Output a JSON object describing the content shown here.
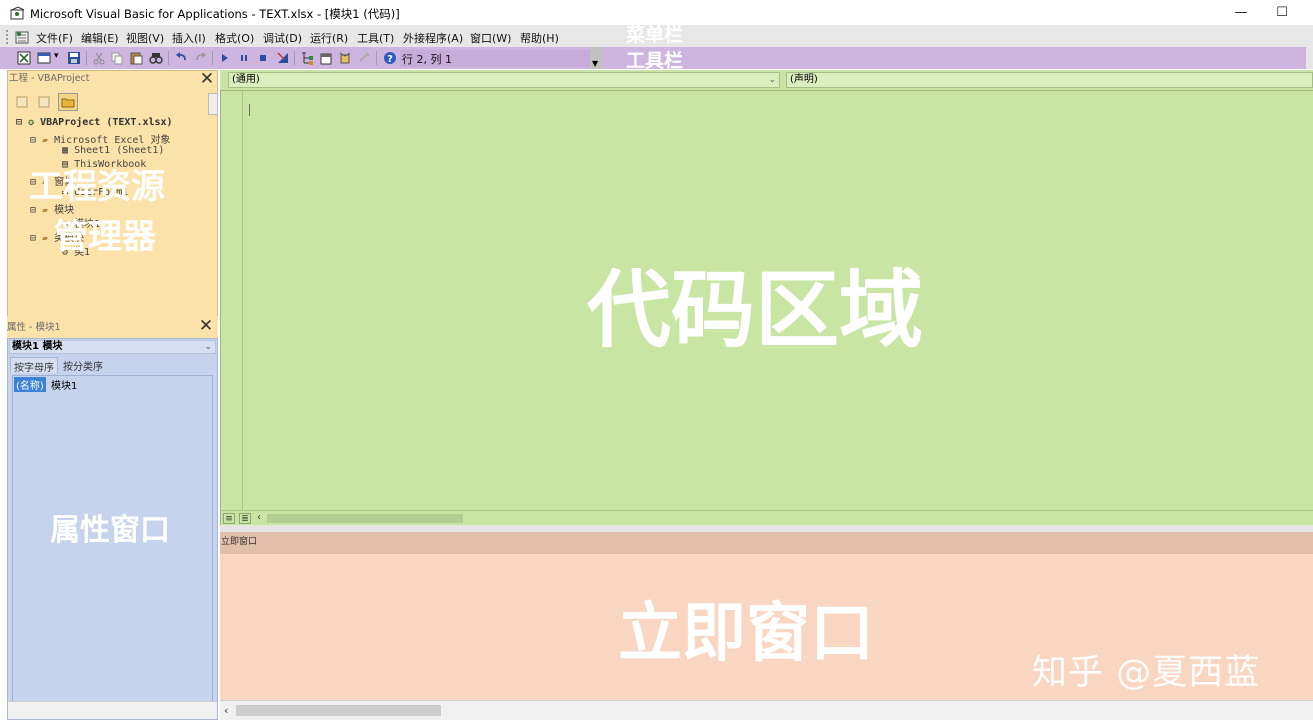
{
  "window": {
    "title": "Microsoft Visual Basic for Applications - TEXT.xlsx - [模块1 (代码)]",
    "minimize_label": "—",
    "maximize_label": "☐"
  },
  "menu": {
    "items": [
      "文件(F)",
      "编辑(E)",
      "视图(V)",
      "插入(I)",
      "格式(O)",
      "调试(D)",
      "运行(R)",
      "工具(T)",
      "外接程序(A)",
      "窗口(W)",
      "帮助(H)"
    ]
  },
  "toolbar": {
    "status": "行 2, 列 1"
  },
  "annotations": {
    "menubar": "菜单栏",
    "toolbar": "工具栏",
    "project_line1": "工程资源",
    "project_line2": "管理器",
    "properties": "属性窗口",
    "code": "代码区域",
    "immediate": "立即窗口"
  },
  "project": {
    "caption": "工程 - VBAProject",
    "close_label": "✕",
    "tree": {
      "root": "VBAProject (TEXT.xlsx)",
      "excel_objects": "Microsoft Excel 对象",
      "sheet1": "Sheet1 (Sheet1)",
      "workbook": "ThisWorkbook",
      "forms": "窗体",
      "userform": "UserForm1",
      "modules": "模块",
      "module1": "模块1",
      "class_modules": "类模块",
      "class1": "类1"
    }
  },
  "properties": {
    "caption": "属性 - 模块1",
    "close_label": "✕",
    "selected_object": "模块1 模块",
    "tabs": [
      "按字母序",
      "按分类序"
    ],
    "rows": [
      {
        "name": "(名称)",
        "value": "模块1"
      }
    ]
  },
  "code": {
    "object_combo": "(通用)",
    "procedure_combo": "(声明)"
  },
  "immediate": {
    "caption": "立即窗口"
  },
  "watermark": "知乎 @夏西蓝",
  "colors": {
    "toolbar": "#cdb5df",
    "project": "#fbe2a8",
    "properties": "#c6d3ec",
    "code": "#c8e5a4",
    "immediate": "#f8d6c1"
  }
}
